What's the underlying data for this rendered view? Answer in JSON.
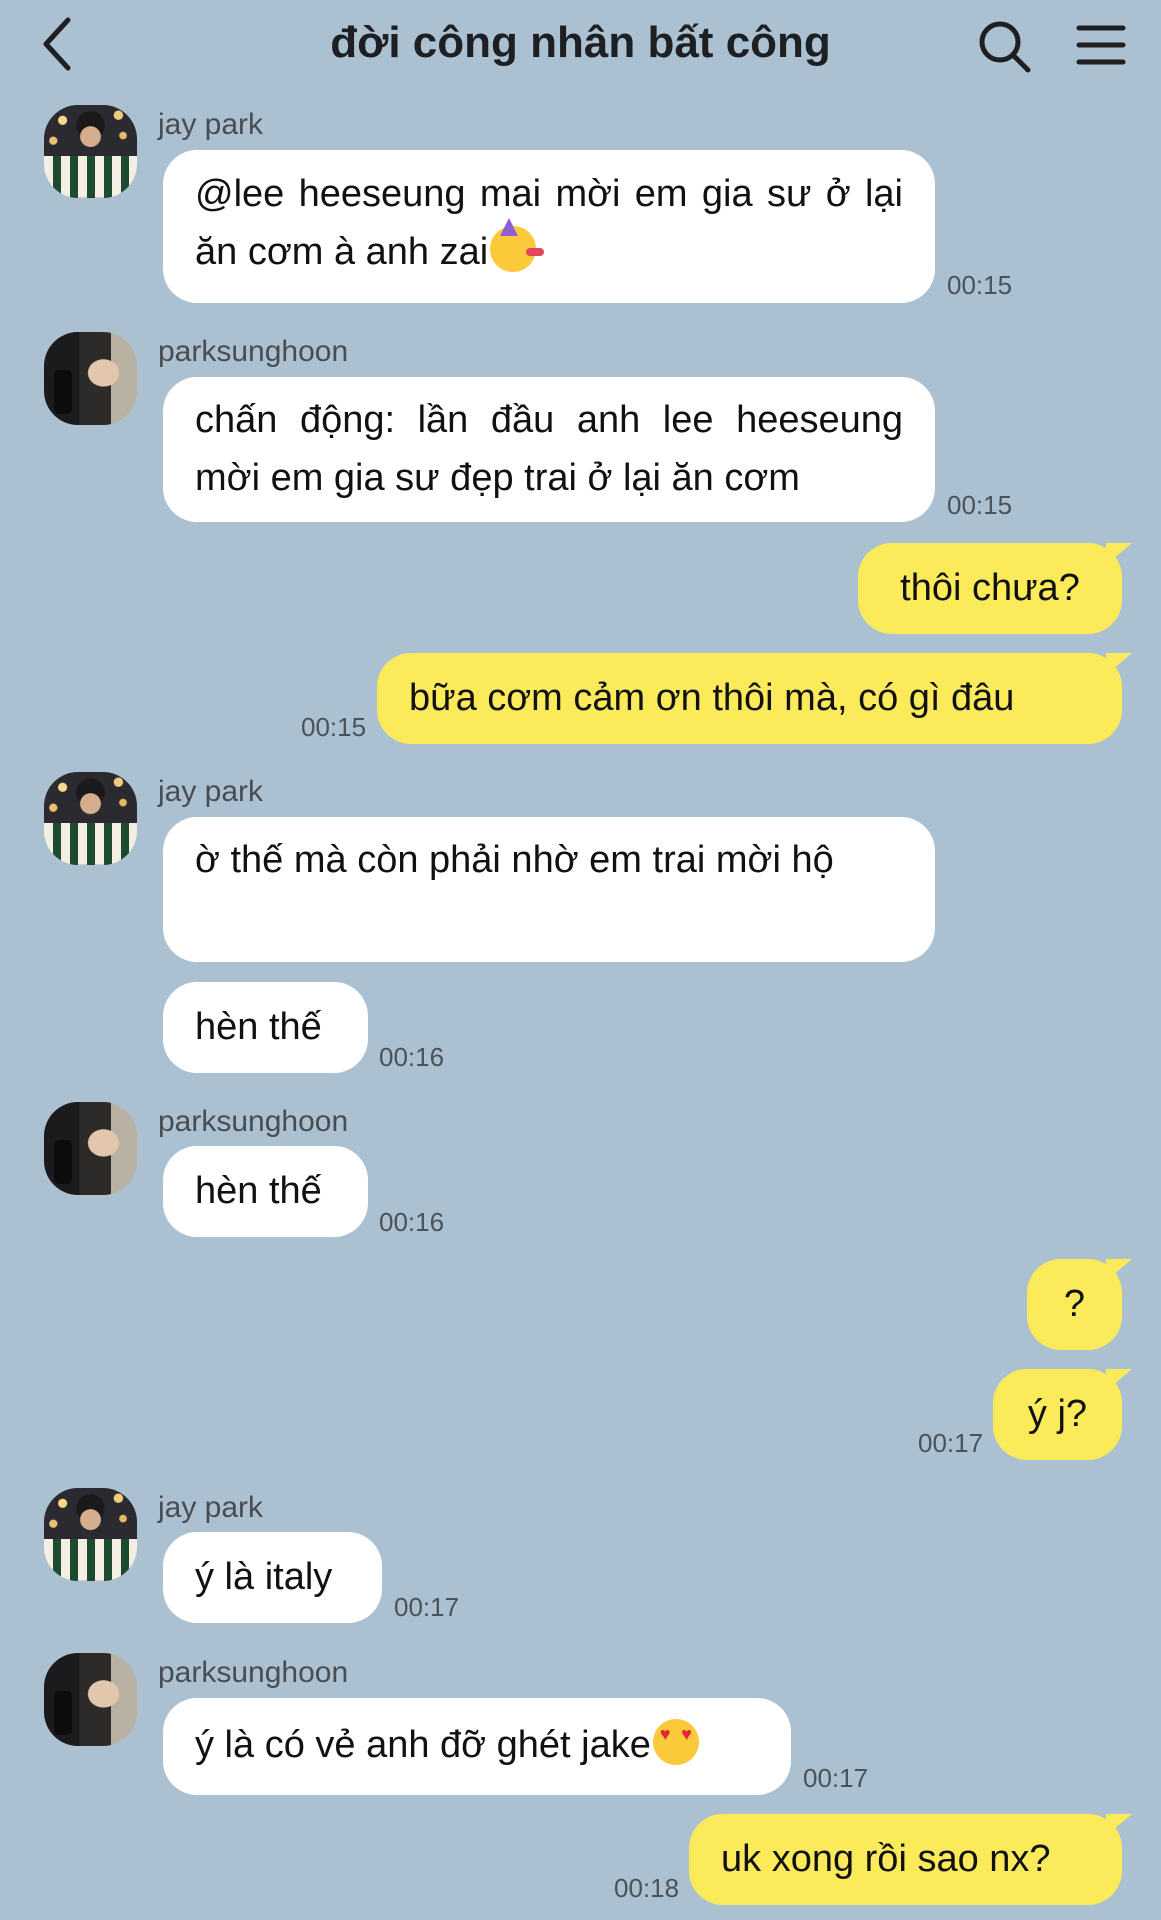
{
  "header": {
    "title": "đời công nhân bất công",
    "back_icon": "chevron-left-icon",
    "search_icon": "search-icon",
    "menu_icon": "hamburger-menu-icon"
  },
  "colors": {
    "background": "#abc1d1",
    "incoming_bubble": "#ffffff",
    "outgoing_bubble": "#fbeb5a"
  },
  "messages": [
    {
      "sender": "jay park",
      "text": "@lee heeseung mai mời em gia sư ở lại ăn cơm à anh zai",
      "emoji": "partying-face-emoji",
      "time": "00:15"
    },
    {
      "sender": "parksunghoon",
      "text": "chấn động: lần đầu anh lee heeseung mời em gia sư đẹp trai ở lại ăn cơm",
      "time": "00:15"
    },
    {
      "sender": "me",
      "text": "thôi chưa?"
    },
    {
      "sender": "me",
      "text": "bữa cơm cảm ơn thôi mà, có gì đâu",
      "time": "00:15"
    },
    {
      "sender": "jay park",
      "text": "ờ thế mà còn phải nhờ em trai mời hộ"
    },
    {
      "sender": "jay park",
      "text": "hèn thế",
      "time": "00:16"
    },
    {
      "sender": "parksunghoon",
      "text": "hèn thế",
      "time": "00:16"
    },
    {
      "sender": "me",
      "text": "?"
    },
    {
      "sender": "me",
      "text": "ý j?",
      "time": "00:17"
    },
    {
      "sender": "jay park",
      "text": "ý là italy",
      "time": "00:17"
    },
    {
      "sender": "parksunghoon",
      "text": "ý là có vẻ anh đỡ ghét jake",
      "emoji": "heart-eyes-emoji",
      "time": "00:17"
    },
    {
      "sender": "me",
      "text": "uk xong rồi sao nx?",
      "time": "00:18"
    }
  ]
}
